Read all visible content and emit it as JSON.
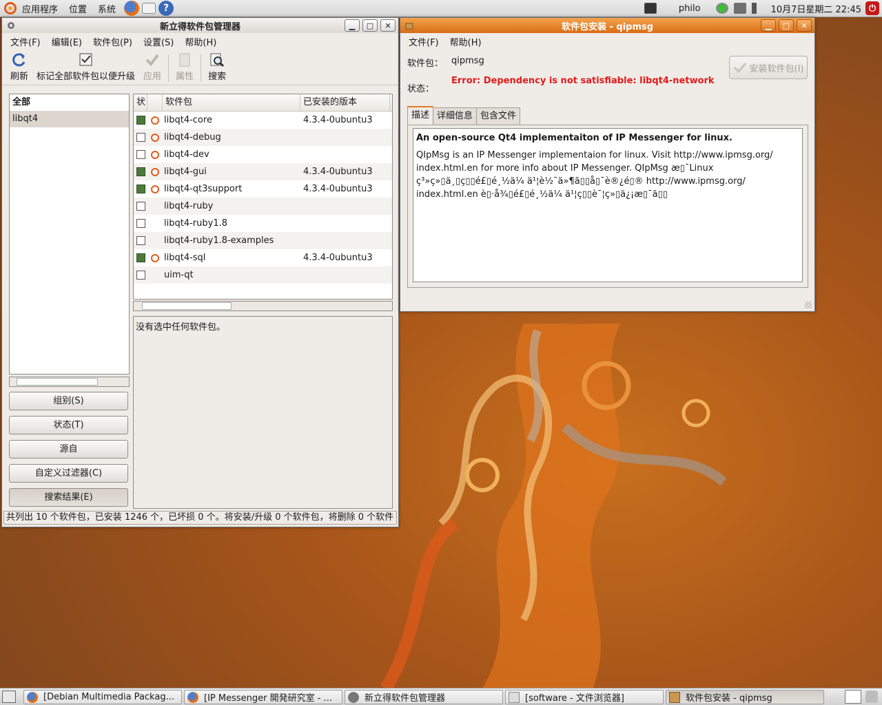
{
  "top_panel": {
    "menus": [
      "应用程序",
      "位置",
      "系统"
    ],
    "user": "philo",
    "clock": "10月7日星期二  22:45"
  },
  "synaptic": {
    "title": "新立得软件包管理器",
    "menu": [
      "文件(F)",
      "编辑(E)",
      "软件包(P)",
      "设置(S)",
      "帮助(H)"
    ],
    "toolbar": {
      "refresh": "刷新",
      "mark_all": "标记全部软件包以便升级",
      "apply": "应用",
      "properties": "属性",
      "search": "搜索"
    },
    "filter_list": [
      {
        "label": "全部",
        "selected": false,
        "heading": true
      },
      {
        "label": "libqt4",
        "selected": true,
        "heading": false
      }
    ],
    "side_buttons": [
      "组别(S)",
      "状态(T)",
      "源自",
      "自定义过滤器(C)",
      "搜索结果(E)"
    ],
    "columns": {
      "status": "状",
      "package": "软件包",
      "installed_version": "已安装的版本"
    },
    "packages": [
      {
        "name": "libqt4-core",
        "installed": true,
        "version": "4.3.4-0ubuntu3",
        "ubuntu_icon": true
      },
      {
        "name": "libqt4-debug",
        "installed": false,
        "version": "",
        "ubuntu_icon": true
      },
      {
        "name": "libqt4-dev",
        "installed": false,
        "version": "",
        "ubuntu_icon": true
      },
      {
        "name": "libqt4-gui",
        "installed": true,
        "version": "4.3.4-0ubuntu3",
        "ubuntu_icon": true
      },
      {
        "name": "libqt4-qt3support",
        "installed": true,
        "version": "4.3.4-0ubuntu3",
        "ubuntu_icon": true
      },
      {
        "name": "libqt4-ruby",
        "installed": false,
        "version": "",
        "ubuntu_icon": false
      },
      {
        "name": "libqt4-ruby1.8",
        "installed": false,
        "version": "",
        "ubuntu_icon": false
      },
      {
        "name": "libqt4-ruby1.8-examples",
        "installed": false,
        "version": "",
        "ubuntu_icon": false
      },
      {
        "name": "libqt4-sql",
        "installed": true,
        "version": "4.3.4-0ubuntu3",
        "ubuntu_icon": true
      },
      {
        "name": "uim-qt",
        "installed": false,
        "version": "",
        "ubuntu_icon": false
      }
    ],
    "description": "没有选中任何软件包。",
    "statusbar": "共列出  10 个软件包，已安装  1246 个，已坏损  0 个。将安装/升级  0 个软件包，将删除  0 个软件"
  },
  "installer": {
    "title": "软件包安装 - qipmsg",
    "menu": [
      "文件(F)",
      "帮助(H)"
    ],
    "package_label": "软件包：",
    "package_value": "qipmsg",
    "status_label": "状态：",
    "status_value": "Error: Dependency is not satisfiable: libqt4-network",
    "install_button": "安装软件包(I)",
    "tabs": [
      "描述",
      "详细信息",
      "包含文件"
    ],
    "desc_title": "An open-source Qt4 implementaiton of IP Messenger for linux.",
    "desc_lines": [
      "QIpMsg is an IP Messenger implementaion for linux. Visit http://www.ipmsg.org/",
      "index.html.en for more info about IP Messenger. QIpMsg æ▯¯Linux",
      "ç³»ç»▯ä¸▯ç▯▯é£▯é¸½ä¼ ä¹¦è½¯ä»¶ã▯▯å▯¯è®¿é▯® http://www.ipmsg.org/",
      "index.html.en è▯·å¾▯é£▯é¸½ä¼ ä¹¦ç▯▯è¯¦ç»▯ä¿¡æ▯¯ã▯▯"
    ]
  },
  "taskbar": [
    {
      "label": "[Debian Multimedia Packag...",
      "current": false
    },
    {
      "label": "[IP Messenger 開発研究室 - ...",
      "current": false
    },
    {
      "label": "新立得软件包管理器",
      "current": false
    },
    {
      "label": "[software - 文件浏览器]",
      "current": false
    },
    {
      "label": "软件包安装 - qipmsg",
      "current": true
    }
  ]
}
